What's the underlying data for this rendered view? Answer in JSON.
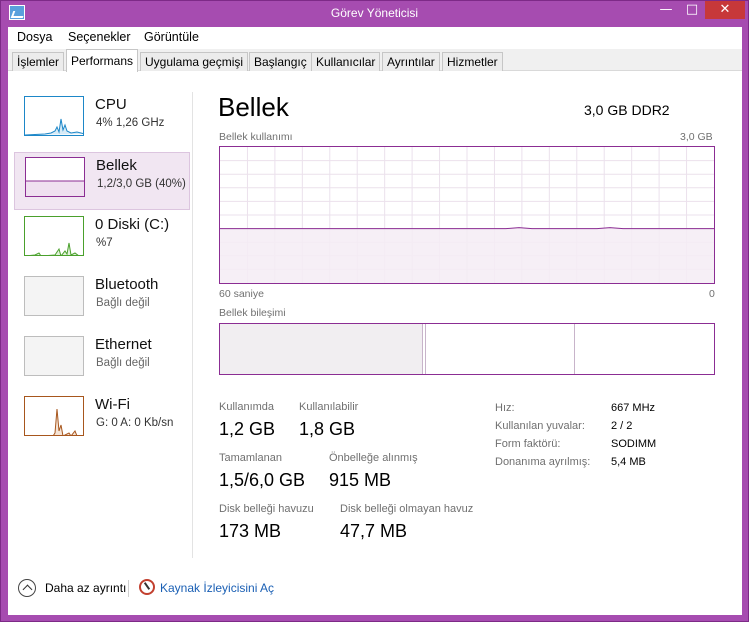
{
  "window": {
    "title": "Görev Yöneticisi",
    "accent_color": "#a64cb0",
    "controls": {
      "minimize": "—",
      "maximize": "□",
      "close": "✕"
    }
  },
  "menu": {
    "file": "Dosya",
    "options": "Seçenekler",
    "view": "Görüntüle"
  },
  "tabs": [
    {
      "label": "İşlemler",
      "active": false
    },
    {
      "label": "Performans",
      "active": true
    },
    {
      "label": "Uygulama geçmişi",
      "active": false
    },
    {
      "label": "Başlangıç",
      "active": false
    },
    {
      "label": "Kullanıcılar",
      "active": false
    },
    {
      "label": "Ayrıntılar",
      "active": false
    },
    {
      "label": "Hizmetler",
      "active": false
    }
  ],
  "sidebar": {
    "items": [
      {
        "name": "CPU",
        "sub": "4% 1,26 GHz",
        "color": "#1d87c8"
      },
      {
        "name": "Bellek",
        "sub": "1,2/3,0 GB (40%)",
        "color": "#8b2d93"
      },
      {
        "name": "0 Diski (C:)",
        "sub": "%7",
        "color": "#4aa02c"
      },
      {
        "name": "Bluetooth",
        "sub": "Bağlı değil",
        "color": "#aaaaaa"
      },
      {
        "name": "Ethernet",
        "sub": "Bağlı değil",
        "color": "#aaaaaa"
      },
      {
        "name": "Wi-Fi",
        "sub": "G: 0 A: 0 Kb/sn",
        "color": "#a7561d"
      }
    ]
  },
  "memory": {
    "title": "Bellek",
    "capacity": "3,0 GB DDR2",
    "usage_label": "Bellek kullanımı",
    "usage_max": "3,0 GB",
    "time_left": "60 saniye",
    "time_right": "0",
    "usage_fraction": 0.4,
    "composition_label": "Bellek bileşimi",
    "composition": {
      "in_use_fraction": 0.41,
      "modified_fraction": 0.008,
      "standby_fraction": 0.3
    },
    "stats": {
      "in_use_label": "Kullanımda",
      "in_use": "1,2 GB",
      "available_label": "Kullanılabilir",
      "available": "1,8 GB",
      "committed_label": "Tamamlanan",
      "committed": "1,5/6,0 GB",
      "cached_label": "Önbelleğe alınmış",
      "cached": "915 MB",
      "paged_label": "Disk belleği havuzu",
      "paged": "173 MB",
      "nonpaged_label": "Disk belleği olmayan havuz",
      "nonpaged": "47,7 MB"
    },
    "props": {
      "speed_label": "Hız:",
      "speed": "667 MHz",
      "slots_label": "Kullanılan yuvalar:",
      "slots": "2 / 2",
      "form_label": "Form faktörü:",
      "form": "SODIMM",
      "reserved_label": "Donanıma ayrılmış:",
      "reserved": "5,4 MB"
    }
  },
  "footer": {
    "fewer_details": "Daha az ayrıntı",
    "resource_monitor": "Kaynak İzleyicisini Aç"
  }
}
